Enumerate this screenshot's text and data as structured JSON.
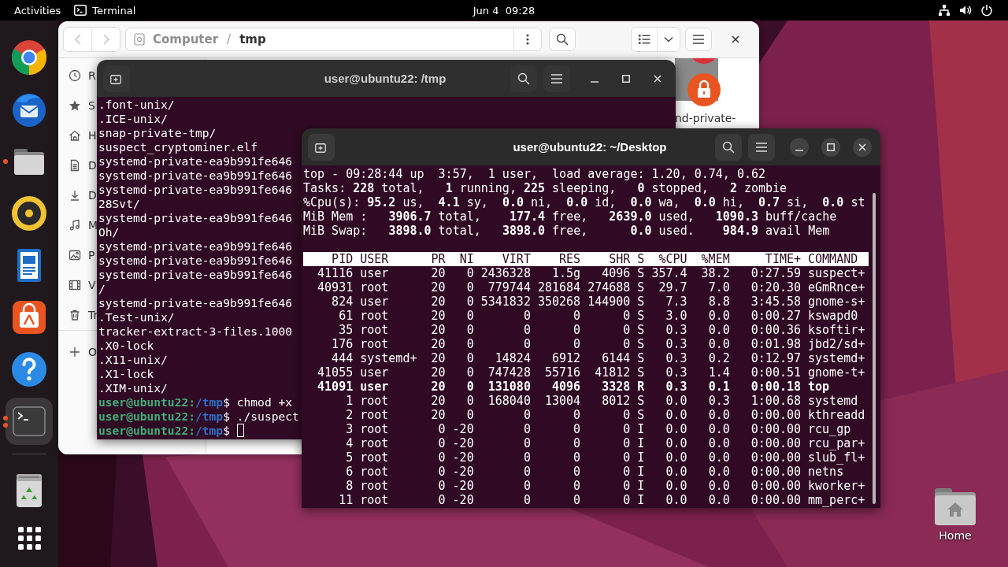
{
  "top_bar": {
    "activities": "Activities",
    "app_name": "Terminal",
    "clock": "Jun 4  09:28"
  },
  "dock": {
    "favorites": [
      {
        "kind": "browser",
        "running": false,
        "selected": false
      },
      {
        "kind": "mail",
        "running": false,
        "selected": false
      },
      {
        "kind": "files",
        "running": true,
        "selected": false,
        "several_windows": false
      },
      {
        "kind": "music",
        "running": false,
        "selected": false
      },
      {
        "kind": "writer",
        "running": false,
        "selected": false
      },
      {
        "kind": "store",
        "running": false,
        "selected": false
      },
      {
        "kind": "help",
        "running": false,
        "selected": false
      },
      {
        "kind": "terminal",
        "running": true,
        "selected": true,
        "several_windows": true
      }
    ],
    "others": [
      {
        "kind": "trash",
        "running": false,
        "selected": false
      }
    ]
  },
  "files_window": {
    "nav": [
      {
        "kind": "back",
        "disabled": true
      },
      {
        "kind": "forward",
        "disabled": true
      }
    ],
    "path": {
      "root": "Computer",
      "separator": "/",
      "folder": "tmp"
    },
    "sidebar": [
      {
        "kind": "recent",
        "label": "R"
      },
      {
        "kind": "starred",
        "label": "S"
      },
      {
        "kind": "home",
        "label": "H"
      },
      {
        "kind": "documents",
        "label": "D"
      },
      {
        "kind": "downloads",
        "label": "D"
      },
      {
        "kind": "music",
        "label": "M"
      },
      {
        "kind": "pictures",
        "label": "P"
      },
      {
        "kind": "videos",
        "label": "V"
      },
      {
        "kind": "trash",
        "label": "Tr"
      },
      {
        "kind": "other",
        "label": "O"
      }
    ],
    "files": [
      {
        "kind": "locked",
        "label": "nd-private-"
      }
    ]
  },
  "terminal_back": {
    "title": "user@ubuntu22: /tmp",
    "active": false,
    "lines": [
      {
        "kind": "output",
        "text": ".font-unix/"
      },
      {
        "kind": "output",
        "text": ".ICE-unix/"
      },
      {
        "kind": "output",
        "text": "snap-private-tmp/"
      },
      {
        "kind": "output",
        "text": "suspect_cryptominer.elf"
      },
      {
        "kind": "output",
        "text": "systemd-private-ea9b991fe646"
      },
      {
        "kind": "output",
        "text": "systemd-private-ea9b991fe646"
      },
      {
        "kind": "output",
        "text": "systemd-private-ea9b991fe646"
      },
      {
        "kind": "output",
        "text": "28Svt/"
      },
      {
        "kind": "output",
        "text": "systemd-private-ea9b991fe646"
      },
      {
        "kind": "output",
        "text": "Oh/"
      },
      {
        "kind": "output",
        "text": "systemd-private-ea9b991fe646"
      },
      {
        "kind": "output",
        "text": "systemd-private-ea9b991fe646"
      },
      {
        "kind": "output",
        "text": "systemd-private-ea9b991fe646"
      },
      {
        "kind": "output",
        "text": "/"
      },
      {
        "kind": "output",
        "text": "systemd-private-ea9b991fe646"
      },
      {
        "kind": "output",
        "text": ".Test-unix/"
      },
      {
        "kind": "output",
        "text": "tracker-extract-3-files.1000"
      },
      {
        "kind": "output",
        "text": ".X0-lock"
      },
      {
        "kind": "output",
        "text": ".X11-unix/"
      },
      {
        "kind": "output",
        "text": ".X1-lock"
      },
      {
        "kind": "output",
        "text": ".XIM-unix/"
      },
      {
        "kind": "prompt",
        "prompt": "user@ubuntu22:",
        "path": "/tmp",
        "command": "$ chmod +x",
        "cursor": false
      },
      {
        "kind": "prompt",
        "prompt": "user@ubuntu22:",
        "path": "/tmp",
        "command": "$ ./suspect",
        "cursor": false
      },
      {
        "kind": "prompt",
        "prompt": "user@ubuntu22:",
        "path": "/tmp",
        "command": "$ ",
        "cursor": true
      }
    ]
  },
  "terminal_front": {
    "title": "user@ubuntu22: ~/Desktop",
    "active": true,
    "summary": [
      "top - 09:28:44 up  3:57,  1 user,  load average: 1.20, 0.74, 0.62",
      "Tasks: **228** total,   **1** running, **225** sleeping,   **0** stopped,   **2** zombie",
      "%Cpu(s): **95.2** us,  **4.1** sy,  **0.0** ni,  **0.0** id,  **0.0** wa,  **0.0** hi,  **0.7** si,  **0.0** st",
      "MiB Mem :   **3906.7** total,    **177.4** free,   **2639.0** used,   **1090.3** buff/cache",
      "MiB Swap:   **3898.0** total,   **3898.0** free,      **0.0** used.    **984.9** avail Mem"
    ],
    "columns": [
      "PID",
      "USER",
      "PR",
      "NI",
      "VIRT",
      "RES",
      "SHR",
      "S",
      "%CPU",
      "%MEM",
      "TIME+",
      "COMMAND"
    ],
    "rows": [
      {
        "cells": [
          "41116",
          "user",
          "20",
          "0",
          "2436328",
          "1.5g",
          "4096",
          "S",
          "357.4",
          "38.2",
          "0:27.59",
          "suspect+"
        ],
        "highlighted": false
      },
      {
        "cells": [
          "40931",
          "root",
          "20",
          "0",
          "779744",
          "281684",
          "274688",
          "S",
          "29.7",
          "7.0",
          "0:20.30",
          "eGmRnce+"
        ],
        "highlighted": false
      },
      {
        "cells": [
          "824",
          "user",
          "20",
          "0",
          "5341832",
          "350268",
          "144900",
          "S",
          "7.3",
          "8.8",
          "3:45.58",
          "gnome-s+"
        ],
        "highlighted": false
      },
      {
        "cells": [
          "61",
          "root",
          "20",
          "0",
          "0",
          "0",
          "0",
          "S",
          "3.0",
          "0.0",
          "0:00.27",
          "kswapd0"
        ],
        "highlighted": false
      },
      {
        "cells": [
          "35",
          "root",
          "20",
          "0",
          "0",
          "0",
          "0",
          "S",
          "0.3",
          "0.0",
          "0:00.36",
          "ksoftir+"
        ],
        "highlighted": false
      },
      {
        "cells": [
          "176",
          "root",
          "20",
          "0",
          "0",
          "0",
          "0",
          "S",
          "0.3",
          "0.0",
          "0:01.98",
          "jbd2/sd+"
        ],
        "highlighted": false
      },
      {
        "cells": [
          "444",
          "systemd+",
          "20",
          "0",
          "14824",
          "6912",
          "6144",
          "S",
          "0.3",
          "0.2",
          "0:12.97",
          "systemd+"
        ],
        "highlighted": false
      },
      {
        "cells": [
          "41055",
          "user",
          "20",
          "0",
          "747428",
          "55716",
          "41812",
          "S",
          "0.3",
          "1.4",
          "0:00.51",
          "gnome-t+"
        ],
        "highlighted": false
      },
      {
        "cells": [
          "41091",
          "user",
          "20",
          "0",
          "131080",
          "4096",
          "3328",
          "R",
          "0.3",
          "0.1",
          "0:00.18",
          "top"
        ],
        "highlighted": true
      },
      {
        "cells": [
          "1",
          "root",
          "20",
          "0",
          "168040",
          "13004",
          "8012",
          "S",
          "0.0",
          "0.3",
          "1:00.68",
          "systemd"
        ],
        "highlighted": false
      },
      {
        "cells": [
          "2",
          "root",
          "20",
          "0",
          "0",
          "0",
          "0",
          "S",
          "0.0",
          "0.0",
          "0:00.00",
          "kthreadd"
        ],
        "highlighted": false
      },
      {
        "cells": [
          "3",
          "root",
          "0",
          "-20",
          "0",
          "0",
          "0",
          "I",
          "0.0",
          "0.0",
          "0:00.00",
          "rcu_gp"
        ],
        "highlighted": false
      },
      {
        "cells": [
          "4",
          "root",
          "0",
          "-20",
          "0",
          "0",
          "0",
          "I",
          "0.0",
          "0.0",
          "0:00.00",
          "rcu_par+"
        ],
        "highlighted": false
      },
      {
        "cells": [
          "5",
          "root",
          "0",
          "-20",
          "0",
          "0",
          "0",
          "I",
          "0.0",
          "0.0",
          "0:00.00",
          "slub_fl+"
        ],
        "highlighted": false
      },
      {
        "cells": [
          "6",
          "root",
          "0",
          "-20",
          "0",
          "0",
          "0",
          "I",
          "0.0",
          "0.0",
          "0:00.00",
          "netns"
        ],
        "highlighted": false
      },
      {
        "cells": [
          "8",
          "root",
          "0",
          "-20",
          "0",
          "0",
          "0",
          "I",
          "0.0",
          "0.0",
          "0:00.00",
          "kworker+"
        ],
        "highlighted": false
      },
      {
        "cells": [
          "11",
          "root",
          "0",
          "-20",
          "0",
          "0",
          "0",
          "I",
          "0.0",
          "0.0",
          "0:00.00",
          "mm_perc+"
        ],
        "highlighted": false
      }
    ]
  },
  "desktop": {
    "icons": [
      {
        "kind": "home",
        "label": "Home"
      }
    ]
  }
}
